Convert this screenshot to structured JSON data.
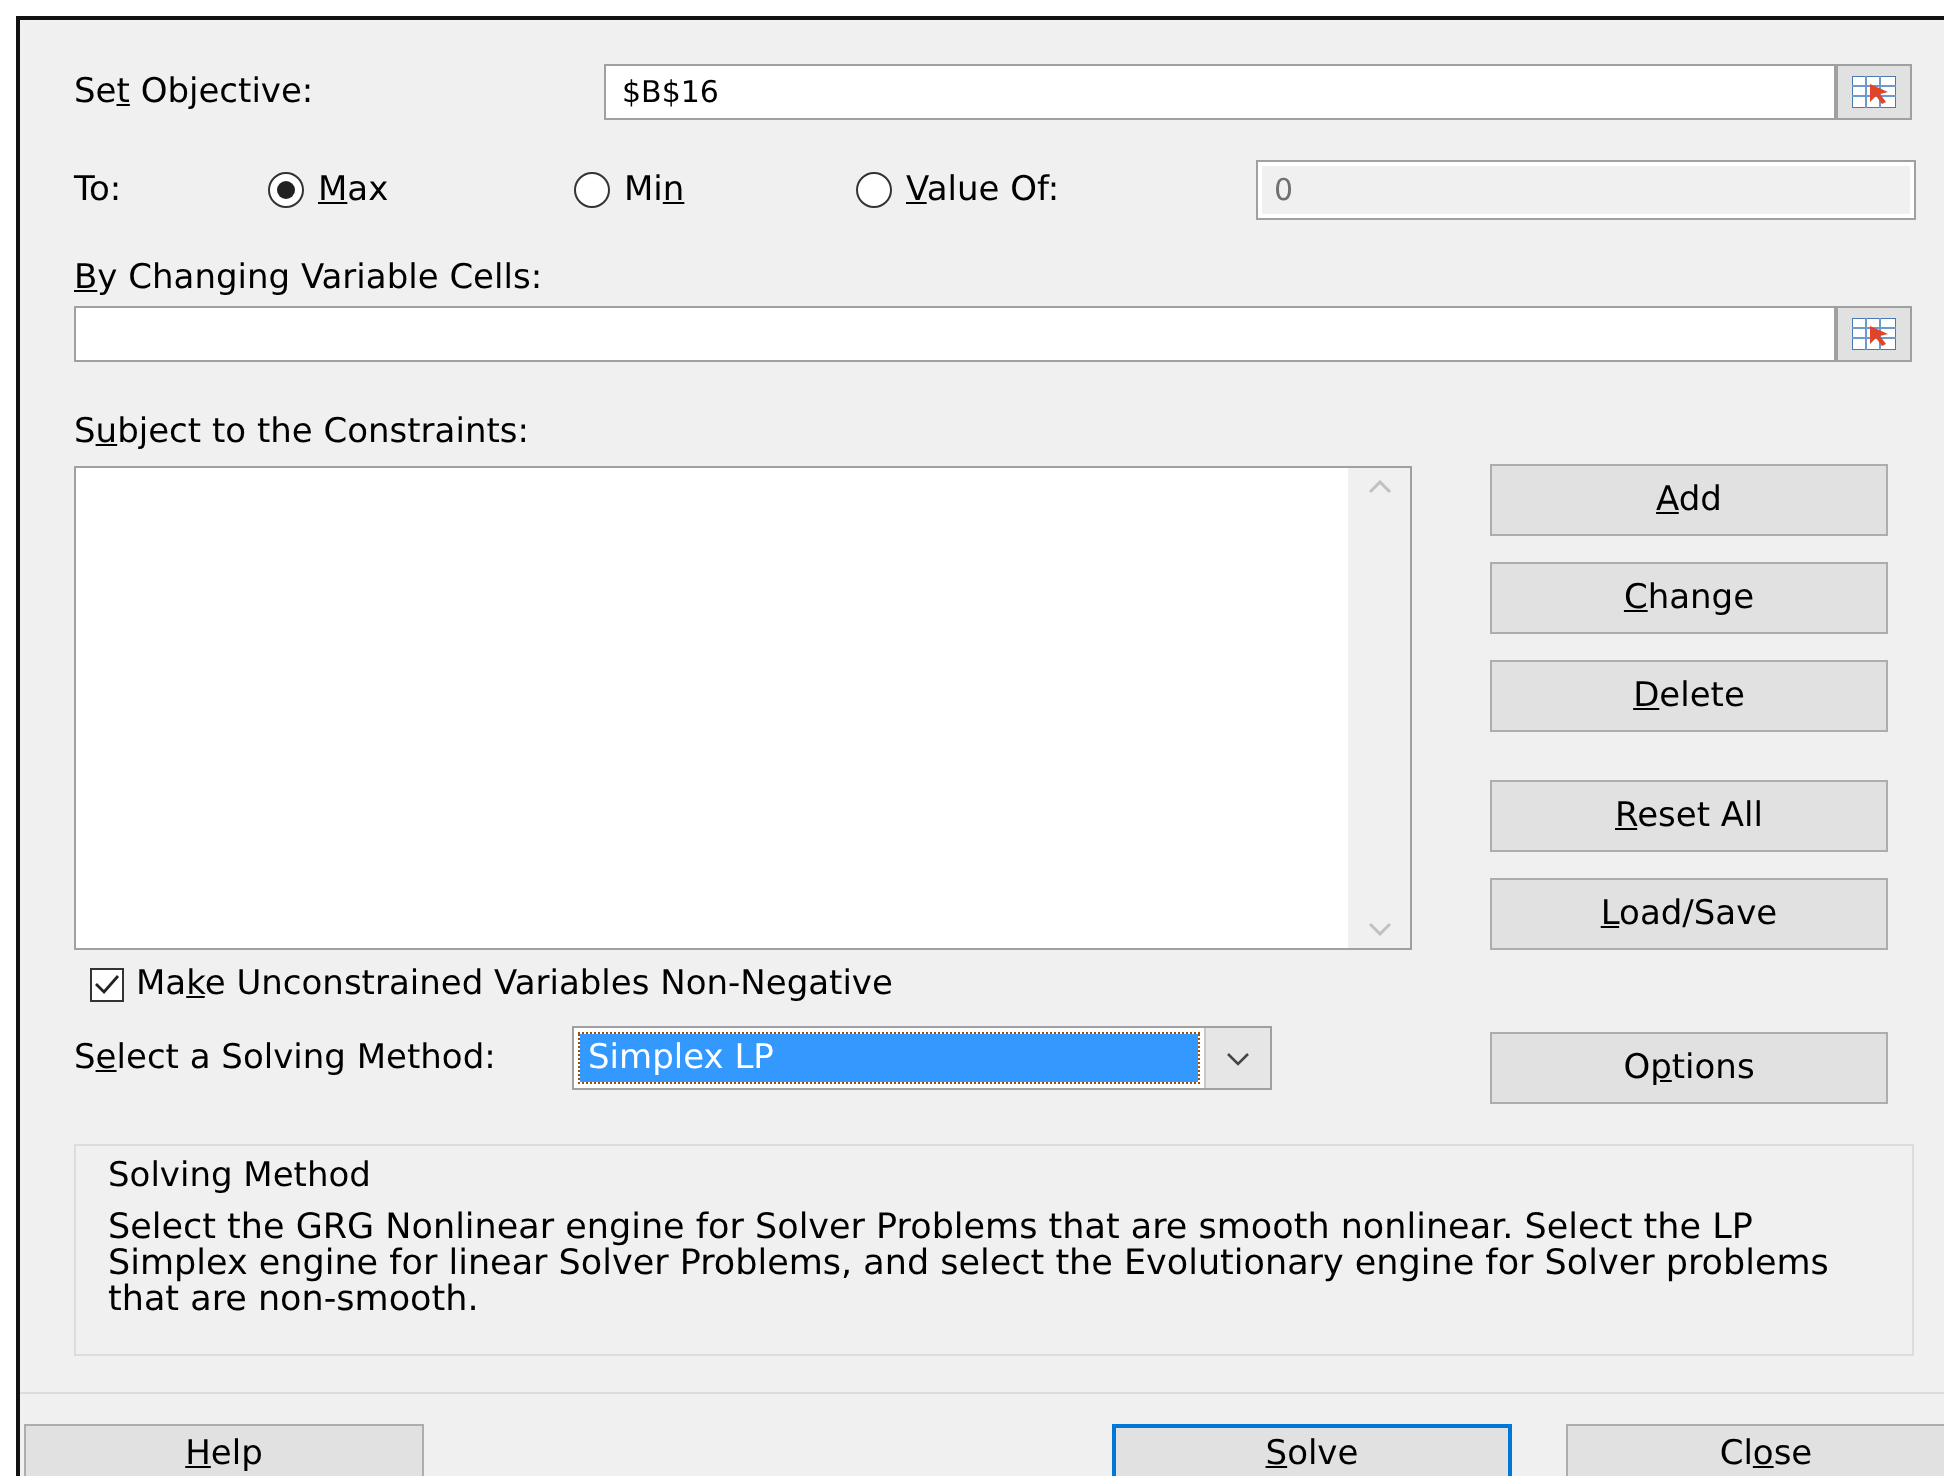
{
  "objective": {
    "label": {
      "pre": "Se",
      "key": "t",
      "post": " Objective:"
    },
    "value": "$B$16"
  },
  "to": {
    "label": "To:",
    "options": [
      {
        "label": {
          "key": "M",
          "post": "ax"
        },
        "selected": true
      },
      {
        "label": {
          "pre": "Mi",
          "key": "n"
        },
        "selected": false
      },
      {
        "label": {
          "key": "V",
          "post": "alue Of:"
        },
        "selected": false
      }
    ],
    "value_of": {
      "value": "0",
      "disabled": true
    }
  },
  "variables": {
    "label": {
      "key": "B",
      "post": "y Changing Variable Cells:"
    }
  },
  "constraints": {
    "label": {
      "pre": "S",
      "key": "u",
      "post": "bject to the Constraints:"
    }
  },
  "constraint_buttons": [
    {
      "label": {
        "key": "A",
        "post": "dd"
      }
    },
    {
      "label": {
        "key": "C",
        "post": "hange"
      }
    },
    {
      "label": {
        "key": "D",
        "post": "elete"
      }
    },
    {
      "label": {
        "key": "R",
        "post": "eset All"
      }
    },
    {
      "label": {
        "key": "L",
        "post": "oad/Save"
      }
    }
  ],
  "non_negative": {
    "label": {
      "pre": "Ma",
      "key": "k",
      "post": "e Unconstrained Variables Non-Negative"
    },
    "checked": true
  },
  "method": {
    "label": {
      "pre": "S",
      "key": "e",
      "post": "lect a Solving Method:"
    },
    "value": "Simplex LP",
    "focused": true
  },
  "options_button": {
    "label": {
      "pre": "O",
      "key": "p",
      "post": "tions"
    }
  },
  "solving_method": {
    "title": "Solving Method",
    "text": "Select the GRG Nonlinear engine for Solver Problems that are smooth nonlinear. Select the LP Simplex engine for linear Solver Problems, and select the Evolutionary engine for Solver problems that are non-smooth."
  },
  "footer_buttons": [
    {
      "label": {
        "key": "H",
        "post": "elp"
      },
      "default": false
    },
    {
      "label": {
        "key": "S",
        "post": "olve"
      },
      "default": true
    },
    {
      "label": {
        "pre": "Cl",
        "key": "o",
        "post": "se"
      },
      "default": false
    }
  ]
}
